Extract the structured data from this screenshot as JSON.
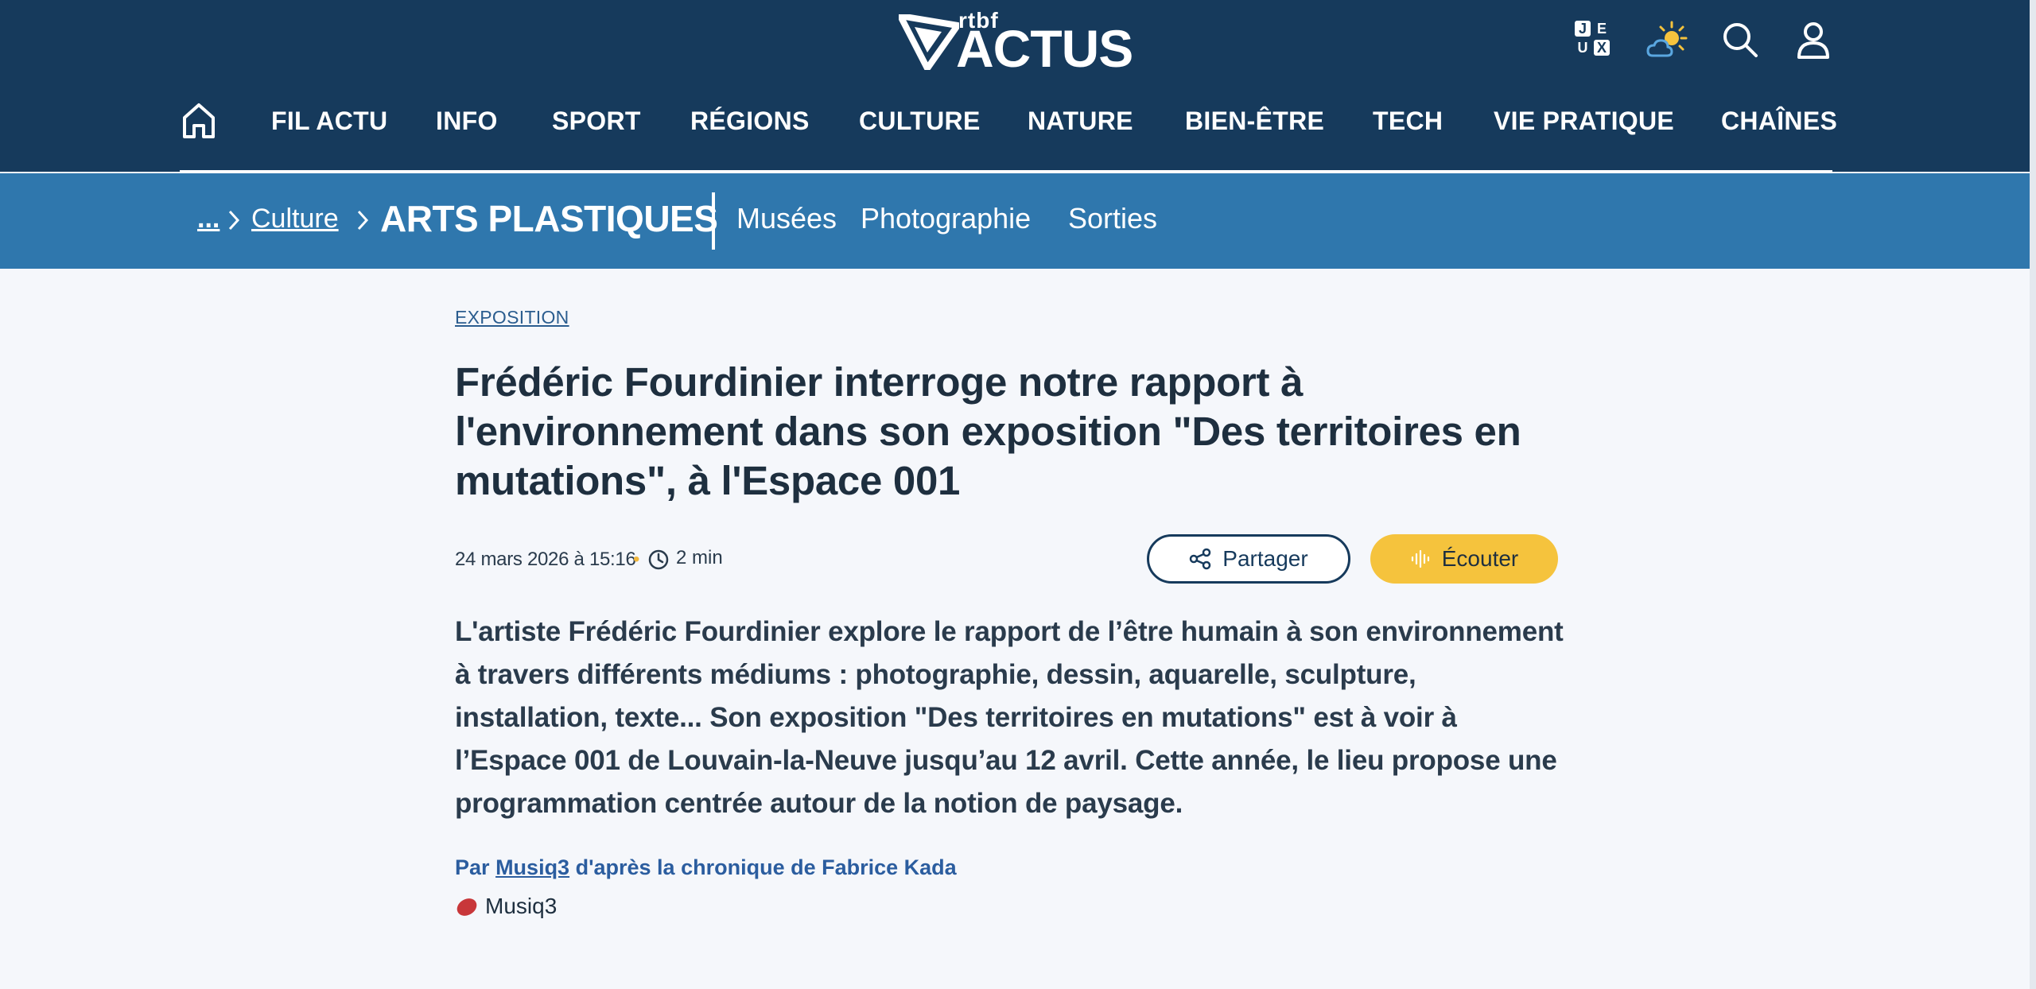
{
  "header": {
    "logo": {
      "brand": "rtbf",
      "product": "ACTUS"
    },
    "icons": {
      "games": {
        "name": "jeux-icon",
        "letters": [
          "J",
          "E",
          "U",
          "X"
        ]
      },
      "weather": "weather-sun-cloud-icon",
      "search": "search-icon",
      "account": "user-icon"
    },
    "nav": {
      "home_icon": "home-icon",
      "items": [
        "FIL ACTU",
        "INFO",
        "SPORT",
        "RÉGIONS",
        "CULTURE",
        "NATURE",
        "BIEN-ÊTRE",
        "TECH",
        "VIE PRATIQUE",
        "CHAÎNES"
      ]
    }
  },
  "subnav": {
    "breadcrumb": {
      "ellipsis": "...",
      "parent": "Culture",
      "current": "ARTS PLASTIQUES"
    },
    "links": [
      "Musées",
      "Photographie",
      "Sorties"
    ]
  },
  "article": {
    "category": "EXPOSITION",
    "title": "Frédéric Fourdinier interroge notre rapport à l'environnement dans son exposition \"Des territoires en mutations\", à l'Espace 001",
    "date": "24 mars 2026 à 15:16",
    "dot": "•",
    "read_time": "2 min",
    "actions": {
      "share": "Partager",
      "listen": "Écouter"
    },
    "lead": "L'artiste Frédéric Fourdinier explore le rapport de l’être humain à son environnement à travers différents médiums : photographie, dessin, aquarelle, sculpture, installation, texte... Son exposition \"Des territoires en mutations\" est à voir à l’Espace 001 de Louvain-la-Neuve jusqu’au 12 avril. Cette année, le lieu propose une programmation centrée autour de la notion de paysage.",
    "byline": {
      "prefix": "Par",
      "author": "Musiq3",
      "suffix": "d'après la chronique de Fabrice Kada"
    },
    "source": {
      "name": "Musiq3",
      "color": "#c8373a"
    }
  },
  "colors": {
    "header_bg": "#163a5c",
    "subnav_bg": "#2f77ad",
    "accent_yellow": "#f5c33d",
    "link_blue": "#2b5d9f"
  }
}
